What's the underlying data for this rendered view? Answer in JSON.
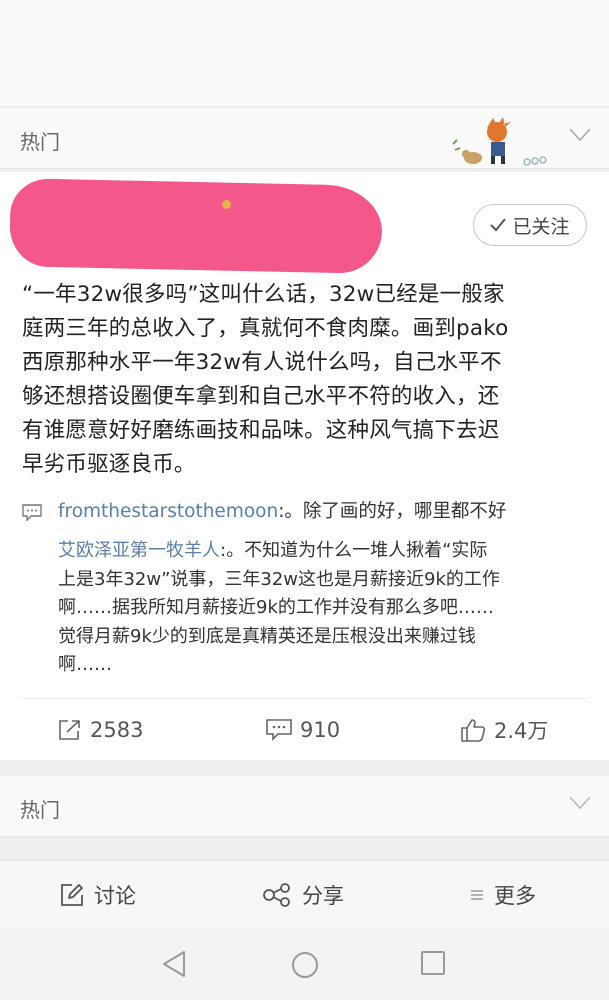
{
  "hot_section": {
    "label": "热门"
  },
  "post": {
    "follow_label": "已关注",
    "text": "“一年32w很多吗”这叫什么话，32w已经是一般家\n庭两三年的总收入了，真就何不食肉糜。画到pako\n西原那种水平一年32w有人说什么吗，自己水平不\n够还想搭设圈便车拿到和自己水平不符的收入，还\n有谁愿意好好磨练画技和品味。这种风气搞下去迟\n早劣币驱逐良币。"
  },
  "comments": [
    {
      "user": "fromthestarstothemoon",
      "text": ":。除了画的好，哪里都不好"
    },
    {
      "user": "艾欧泽亚第一牧羊人",
      "text": ":。不知道为什么一堆人揪着“实际\n上是3年32w”说事，三年32w这也是月薪接近9k的工作\n啊……据我所知月薪接近9k的工作并没有那么多吧……\n觉得月薪9k少的到底是真精英还是压根没出来赚过钱\n啊……"
    }
  ],
  "actions": {
    "share_count": "2583",
    "comment_count": "910",
    "like_count": "2.4万"
  },
  "second_section": {
    "label": "热门"
  },
  "bottom_bar": {
    "discuss_label": "讨论",
    "share_label": "分享",
    "more_label": "更多"
  },
  "icons": [
    "chevron-down-icon",
    "checkmark-icon",
    "comment-icon",
    "share-icon",
    "like-icon",
    "edit-icon",
    "share-nodes-icon",
    "menu-icon",
    "back-icon",
    "home-icon",
    "recents-icon"
  ],
  "colors": {
    "username": "#5a7fa8",
    "redaction": "#f4578a",
    "text": "#222222"
  }
}
